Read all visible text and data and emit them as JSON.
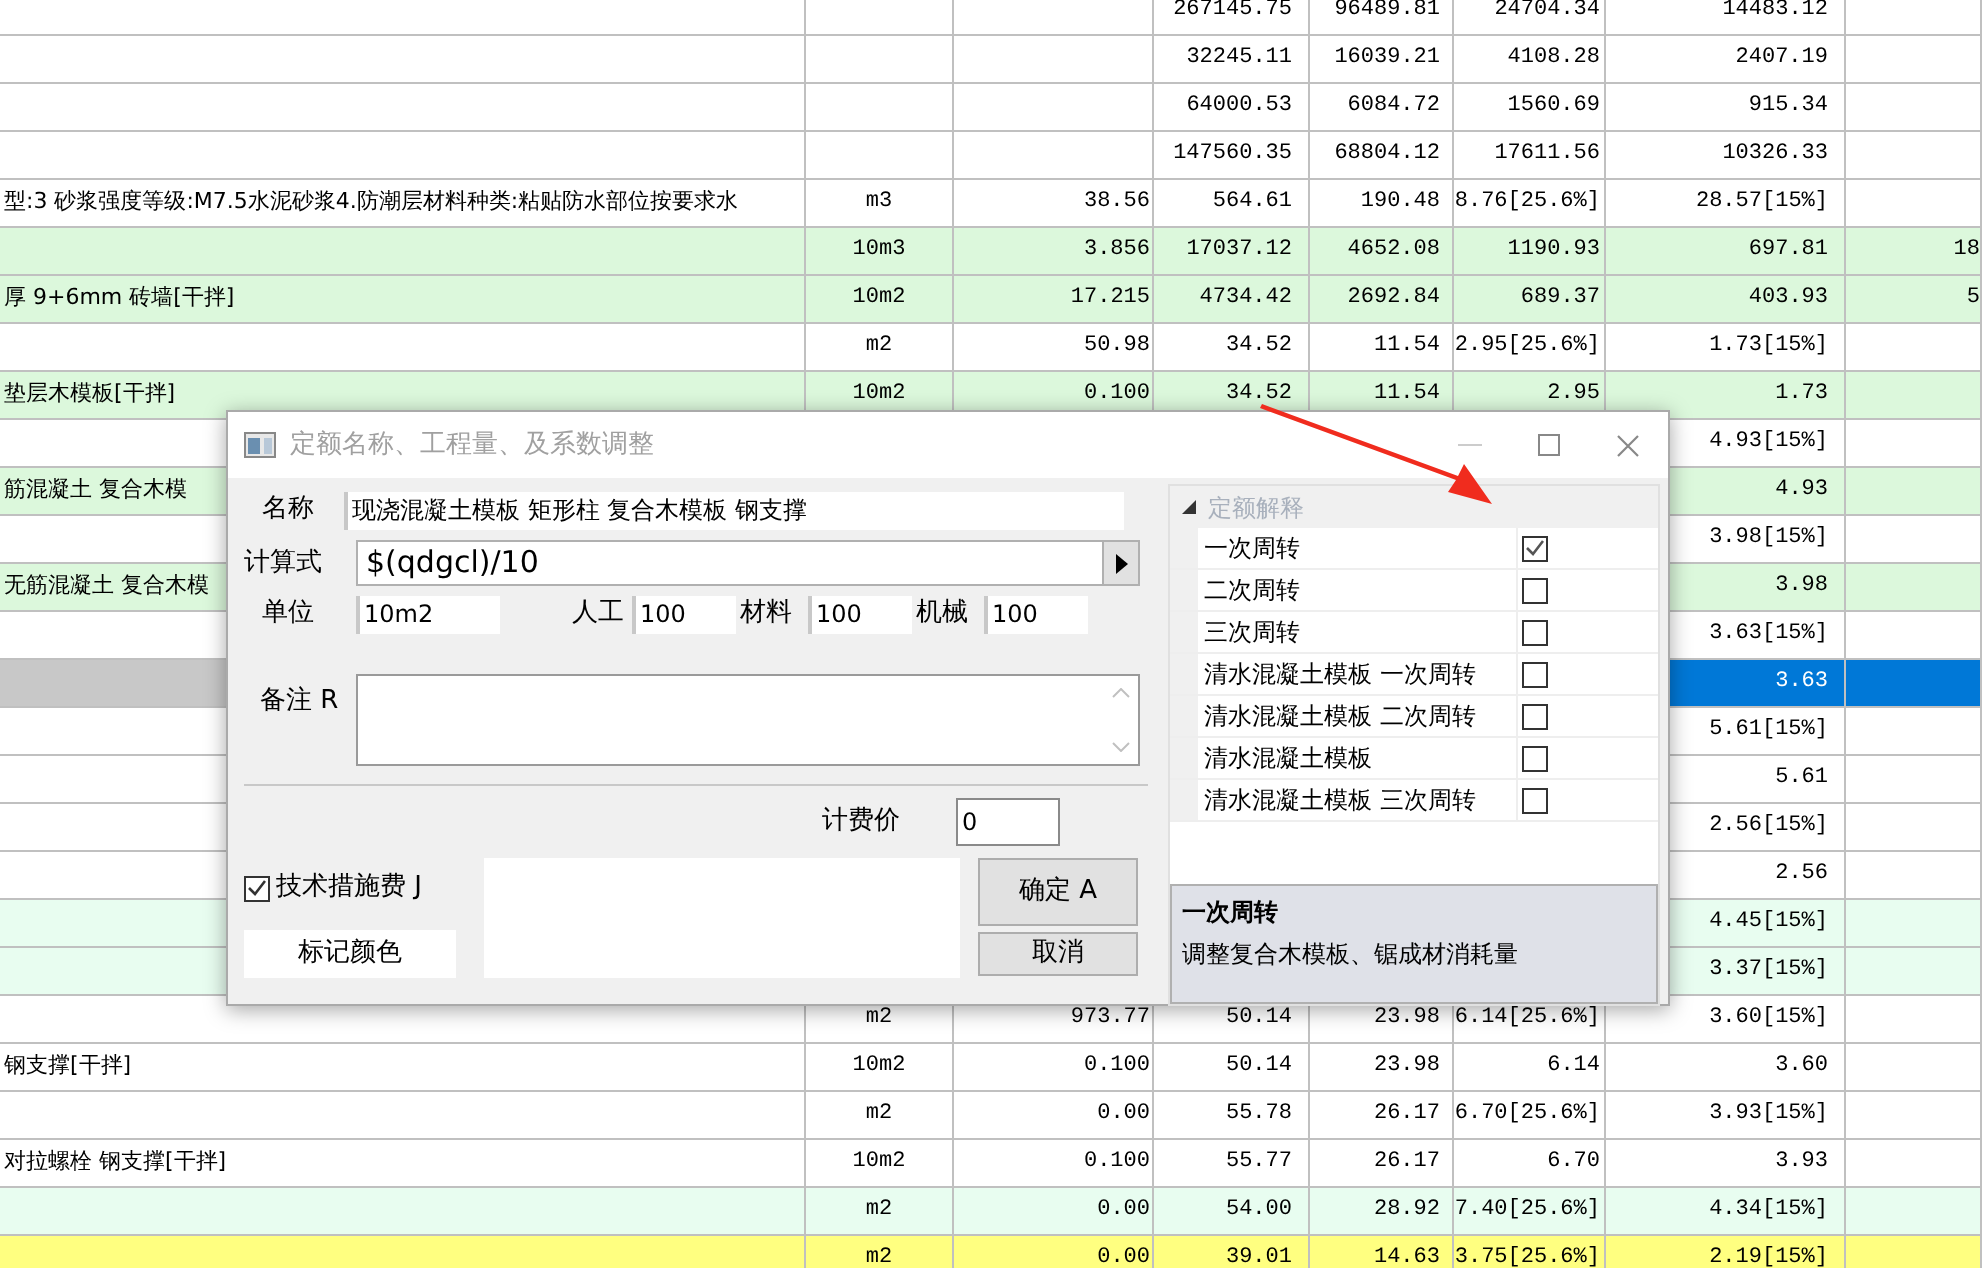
{
  "table": {
    "rows": [
      {
        "kind": "plain",
        "selected": false,
        "cells": {
          "column_4": "267145.75",
          "column_5": "96489.81",
          "column_6": "24704.34",
          "column_7": "14483.12"
        }
      },
      {
        "kind": "plain",
        "selected": false,
        "cells": {
          "column_4": "32245.11",
          "column_5": "16039.21",
          "column_6": "4108.28",
          "column_7": "2407.19"
        }
      },
      {
        "kind": "plain",
        "selected": false,
        "cells": {
          "column_4": "64000.53",
          "column_5": "6084.72",
          "column_6": "1560.69",
          "column_7": "915.34"
        }
      },
      {
        "kind": "plain",
        "selected": false,
        "cells": {
          "column_4": "147560.35",
          "column_5": "68804.12",
          "column_6": "17611.56",
          "column_7": "10326.33"
        }
      },
      {
        "kind": "plain",
        "selected": false,
        "cells": {
          "column_1": "型:3 砂浆强度等级:M7.5水泥砂浆4.防潮层材料种类:粘贴防水部位按要求水",
          "column_2": "m3",
          "column_3": "38.56",
          "column_4": "564.61",
          "column_5": "190.48",
          "column_6": "8.76[25.6%]",
          "column_7": "28.57[15%]"
        }
      },
      {
        "kind": "green",
        "selected": false,
        "cells": {
          "column_2": "10m3",
          "column_3": "3.856",
          "column_4": "17037.12",
          "column_5": "4652.08",
          "column_6": "1190.93",
          "column_7": "697.81",
          "column_8": "18"
        }
      },
      {
        "kind": "green",
        "selected": false,
        "cells": {
          "column_1": "厚 9+6mm 砖墙[干拌]",
          "column_2": "10m2",
          "column_3": "17.215",
          "column_4": "4734.42",
          "column_5": "2692.84",
          "column_6": "689.37",
          "column_7": "403.93",
          "column_8": "5"
        }
      },
      {
        "kind": "plain",
        "selected": false,
        "cells": {
          "column_2": "m2",
          "column_3": "50.98",
          "column_4": "34.52",
          "column_5": "11.54",
          "column_6": "2.95[25.6%]",
          "column_7": "1.73[15%]"
        }
      },
      {
        "kind": "green",
        "selected": false,
        "cells": {
          "column_1": "垫层木模板[干拌]",
          "column_2": "10m2",
          "column_3": "0.100",
          "column_4": "34.52",
          "column_5": "11.54",
          "column_6": "2.95",
          "column_7": "1.73"
        }
      },
      {
        "kind": "plain",
        "selected": false,
        "cells": {
          "column_7": "4.93[15%]"
        }
      },
      {
        "kind": "green",
        "selected": false,
        "cells": {
          "column_1": "筋混凝土 复合木模",
          "column_7": "4.93"
        }
      },
      {
        "kind": "plain",
        "selected": false,
        "cells": {
          "column_7": "3.98[15%]"
        }
      },
      {
        "kind": "green",
        "selected": false,
        "cells": {
          "column_1": "无筋混凝土 复合木模",
          "column_7": "3.98"
        }
      },
      {
        "kind": "plain",
        "selected": false,
        "cells": {
          "column_7": "3.63[15%]"
        }
      },
      {
        "kind": "plain",
        "selected": true,
        "cells": {
          "column_7": "3.63"
        }
      },
      {
        "kind": "plain",
        "selected": false,
        "cells": {
          "column_7": "5.61[15%]"
        }
      },
      {
        "kind": "plain",
        "selected": false,
        "cells": {
          "column_7": "5.61"
        }
      },
      {
        "kind": "plain",
        "selected": false,
        "cells": {
          "column_7": "2.56[15%]"
        }
      },
      {
        "kind": "plain",
        "selected": false,
        "cells": {
          "column_7": "2.56"
        }
      },
      {
        "kind": "mint",
        "selected": false,
        "cells": {
          "column_7": "4.45[15%]"
        }
      },
      {
        "kind": "mint",
        "selected": false,
        "cells": {
          "column_7": "3.37[15%]"
        }
      },
      {
        "kind": "plain",
        "selected": false,
        "cells": {
          "column_2": "m2",
          "column_3": "973.77",
          "column_4": "50.14",
          "column_5": "23.98",
          "column_6": "6.14[25.6%]",
          "column_7": "3.60[15%]"
        }
      },
      {
        "kind": "plain",
        "selected": false,
        "cells": {
          "column_1": "钢支撑[干拌]",
          "column_2": "10m2",
          "column_3": "0.100",
          "column_4": "50.14",
          "column_5": "23.98",
          "column_6": "6.14",
          "column_7": "3.60"
        }
      },
      {
        "kind": "plain",
        "selected": false,
        "cells": {
          "column_2": "m2",
          "column_3": "0.00",
          "column_4": "55.78",
          "column_5": "26.17",
          "column_6": "6.70[25.6%]",
          "column_7": "3.93[15%]"
        }
      },
      {
        "kind": "plain",
        "selected": false,
        "cells": {
          "column_1": "对拉螺栓 钢支撑[干拌]",
          "column_2": "10m2",
          "column_3": "0.100",
          "column_4": "55.77",
          "column_5": "26.17",
          "column_6": "6.70",
          "column_7": "3.93"
        }
      },
      {
        "kind": "mint",
        "selected": false,
        "cells": {
          "column_2": "m2",
          "column_3": "0.00",
          "column_4": "54.00",
          "column_5": "28.92",
          "column_6": "7.40[25.6%]",
          "column_7": "4.34[15%]"
        }
      },
      {
        "kind": "yellow",
        "selected": false,
        "cells": {
          "column_2": "m2",
          "column_3": "0.00",
          "column_4": "39.01",
          "column_5": "14.63",
          "column_6": "3.75[25.6%]",
          "column_7": "2.19[15%]"
        }
      }
    ]
  },
  "dialog": {
    "title": "定额名称、工程量、及系数调整",
    "name_field": {
      "label": "名称",
      "value": "现浇混凝土模板 矩形柱 复合木模板 钢支撑"
    },
    "formula_field": {
      "label": "计算式",
      "value": "$(qdgcl)/10"
    },
    "unit_row": [
      {
        "label": "单位",
        "value": "10m2"
      },
      {
        "label": "人工",
        "value": "100"
      },
      {
        "label": "材料",
        "value": "100"
      },
      {
        "label": "机械",
        "value": "100"
      }
    ],
    "remark": {
      "label": "备注 R"
    },
    "fee": {
      "label": "计费价",
      "value": "0"
    },
    "tech_checkbox": {
      "label": "技术措施费 J",
      "checked": true
    },
    "color_button": "标记颜色",
    "ok_button": "确定 A",
    "cancel_button": "取消",
    "explain": {
      "header": "定额解释",
      "expanded": true,
      "items": [
        {
          "label": "一次周转",
          "checked": true
        },
        {
          "label": "二次周转",
          "checked": false
        },
        {
          "label": "三次周转",
          "checked": false
        },
        {
          "label": "清水混凝土模板 一次周转",
          "checked": false
        },
        {
          "label": "清水混凝土模板 二次周转",
          "checked": false
        },
        {
          "label": "清水混凝土模板",
          "checked": false
        },
        {
          "label": "清水混凝土模板 三次周转",
          "checked": false
        }
      ],
      "description": {
        "title": "一次周转",
        "text": "调整复合木模板、锯成材消耗量"
      }
    }
  }
}
